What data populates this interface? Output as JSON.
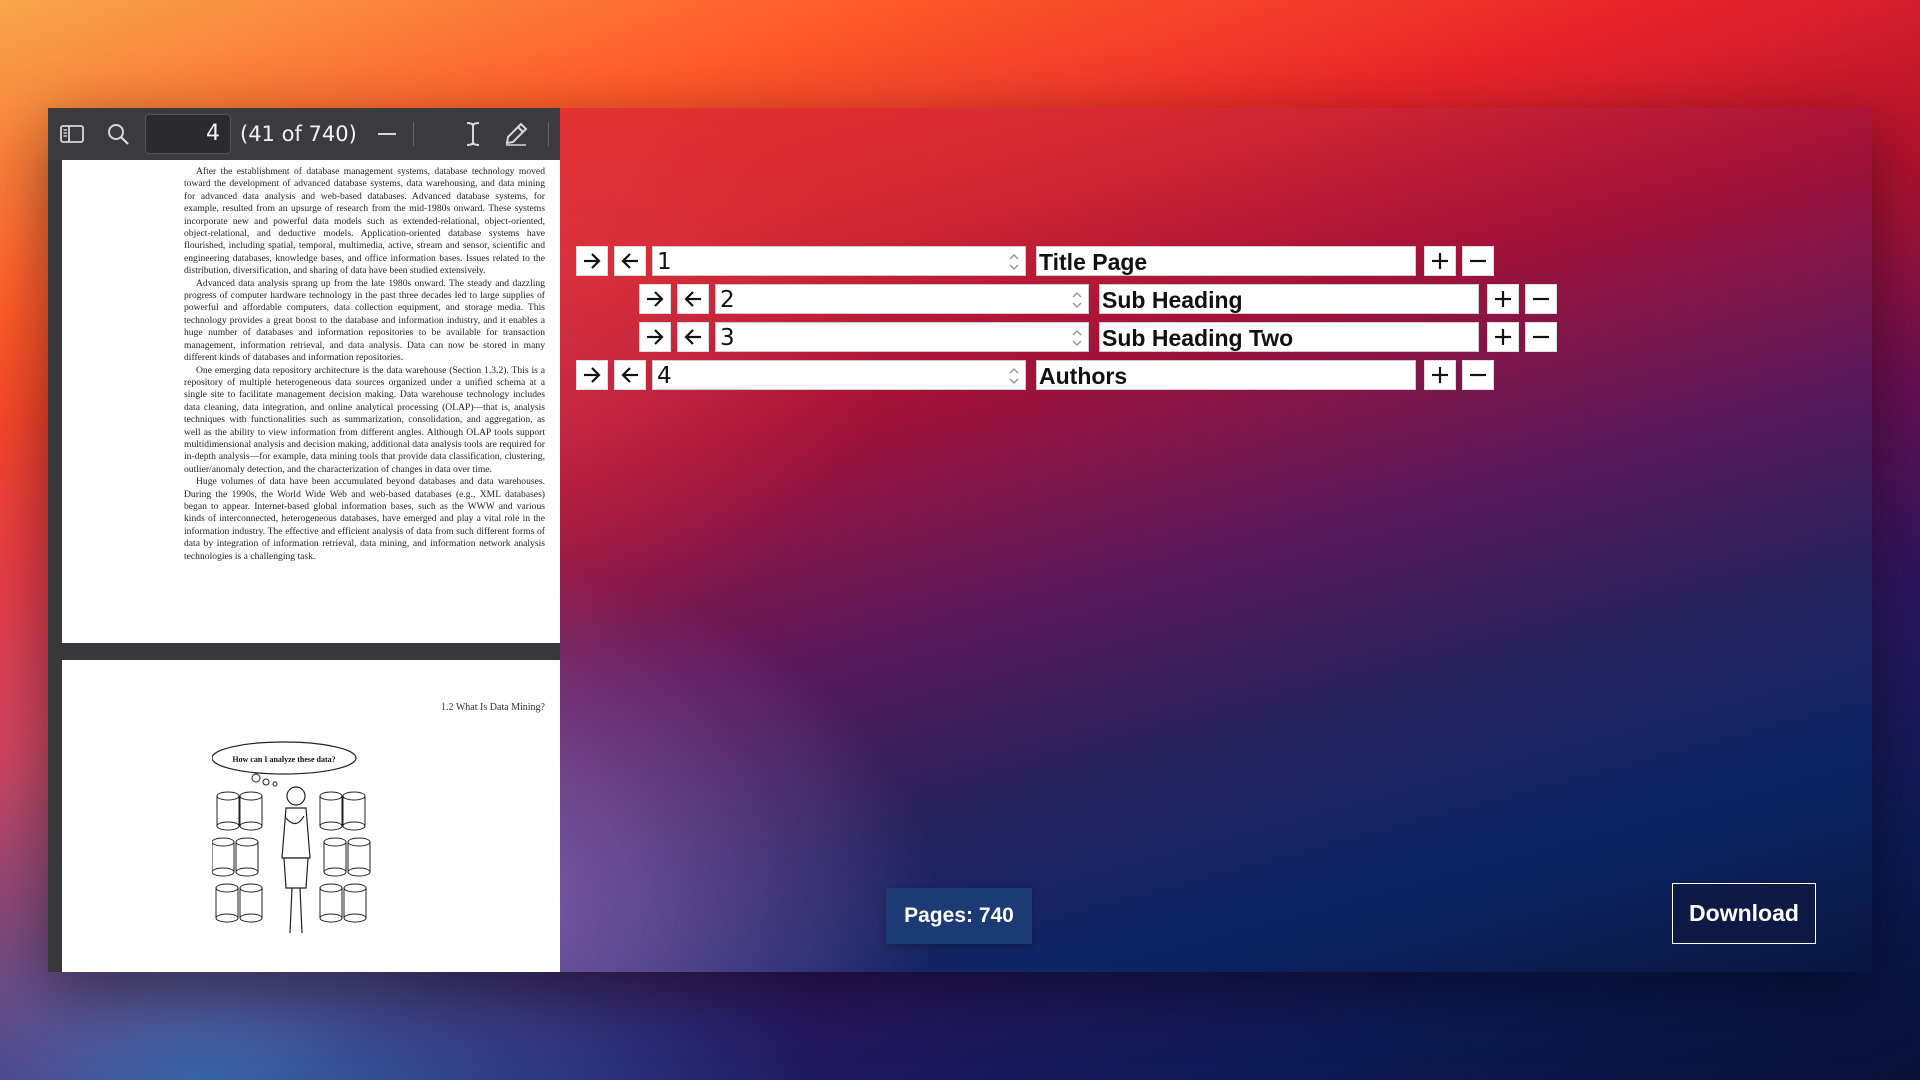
{
  "viewer": {
    "current_page": "4",
    "page_count_text": "(41 of 740)",
    "running_head": "1.2  What Is Data Mining?",
    "thought_bubble": "How can I analyze these data?",
    "paragraphs": [
      "After the establishment of database management systems, database technology moved toward the development of advanced database systems, data warehousing, and data mining for advanced data analysis and web-based databases. Advanced database systems, for example, resulted from an upsurge of research from the mid-1980s onward. These systems incorporate new and powerful data models such as extended-relational, object-oriented, object-relational, and deductive models. Application-oriented database systems have flourished, including spatial, temporal, multimedia, active, stream and sensor, scientific and engineering databases, knowledge bases, and office information bases. Issues related to the distribution, diversification, and sharing of data have been studied extensively.",
      "Advanced data analysis sprang up from the late 1980s onward. The steady and dazzling progress of computer hardware technology in the past three decades led to large supplies of powerful and affordable computers, data collection equipment, and storage media. This technology provides a great boost to the database and information industry, and it enables a huge number of databases and information repositories to be available for transaction management, information retrieval, and data analysis. Data can now be stored in many different kinds of databases and information repositories.",
      "One emerging data repository architecture is the data warehouse (Section 1.3.2). This is a repository of multiple heterogeneous data sources organized under a unified schema at a single site to facilitate management decision making. Data warehouse technology includes data cleaning, data integration, and online analytical processing (OLAP)—that is, analysis techniques with functionalities such as summarization, consolidation, and aggregation, as well as the ability to view information from different angles. Although OLAP tools support multidimensional analysis and decision making, additional data analysis tools are required for in-depth analysis—for example, data mining tools that provide data classification, clustering, outlier/anomaly detection, and the characterization of changes in data over time.",
      "Huge volumes of data have been accumulated beyond databases and data warehouses. During the 1990s, the World Wide Web and web-based databases (e.g., XML databases) began to appear. Internet-based global information bases, such as the WWW and various kinds of interconnected, heterogeneous databases, have emerged and play a vital role in the information industry. The effective and efficient analysis of data from such different forms of data by integration of information retrieval, data mining, and information network analysis technologies is a challenging task."
    ]
  },
  "outline": [
    {
      "page": "1",
      "title": "Title Page"
    },
    {
      "page": "2",
      "title": "Sub Heading"
    },
    {
      "page": "3",
      "title": "Sub Heading Two"
    },
    {
      "page": "4",
      "title": "Authors"
    }
  ],
  "footer": {
    "pages_label": "Pages: 740",
    "download_label": "Download"
  },
  "icons": [
    "sidebar-toggle-icon",
    "search-icon",
    "zoom-out-icon",
    "text-cursor-icon",
    "pen-icon",
    "arrow-right-icon",
    "arrow-left-icon",
    "plus-icon",
    "minus-icon",
    "spinner-icon"
  ]
}
